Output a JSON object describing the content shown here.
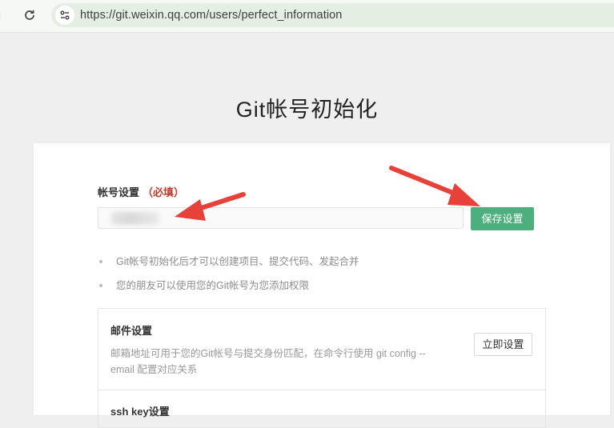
{
  "browser": {
    "url": "https://git.weixin.qq.com/users/perfect_information"
  },
  "page": {
    "heading": "Git帐号初始化"
  },
  "account": {
    "label": "帐号设置",
    "required": "（必填）",
    "save_button": "保存设置"
  },
  "tips": [
    "Git帐号初始化后才可以创建项目、提交代码、发起合并",
    "您的朋友可以使用您的Git帐号为您添加权限"
  ],
  "mail": {
    "title": "邮件设置",
    "description": "邮箱地址可用于您的Git帐号与提交身份匹配，在命令行使用 git config --email 配置对应关系",
    "setup_button": "立即设置"
  },
  "ssh": {
    "title": "ssh key设置"
  },
  "colors": {
    "accent_green": "#4caf7d",
    "required_red": "#c0392b",
    "annotation_arrow": "#e8413a"
  }
}
